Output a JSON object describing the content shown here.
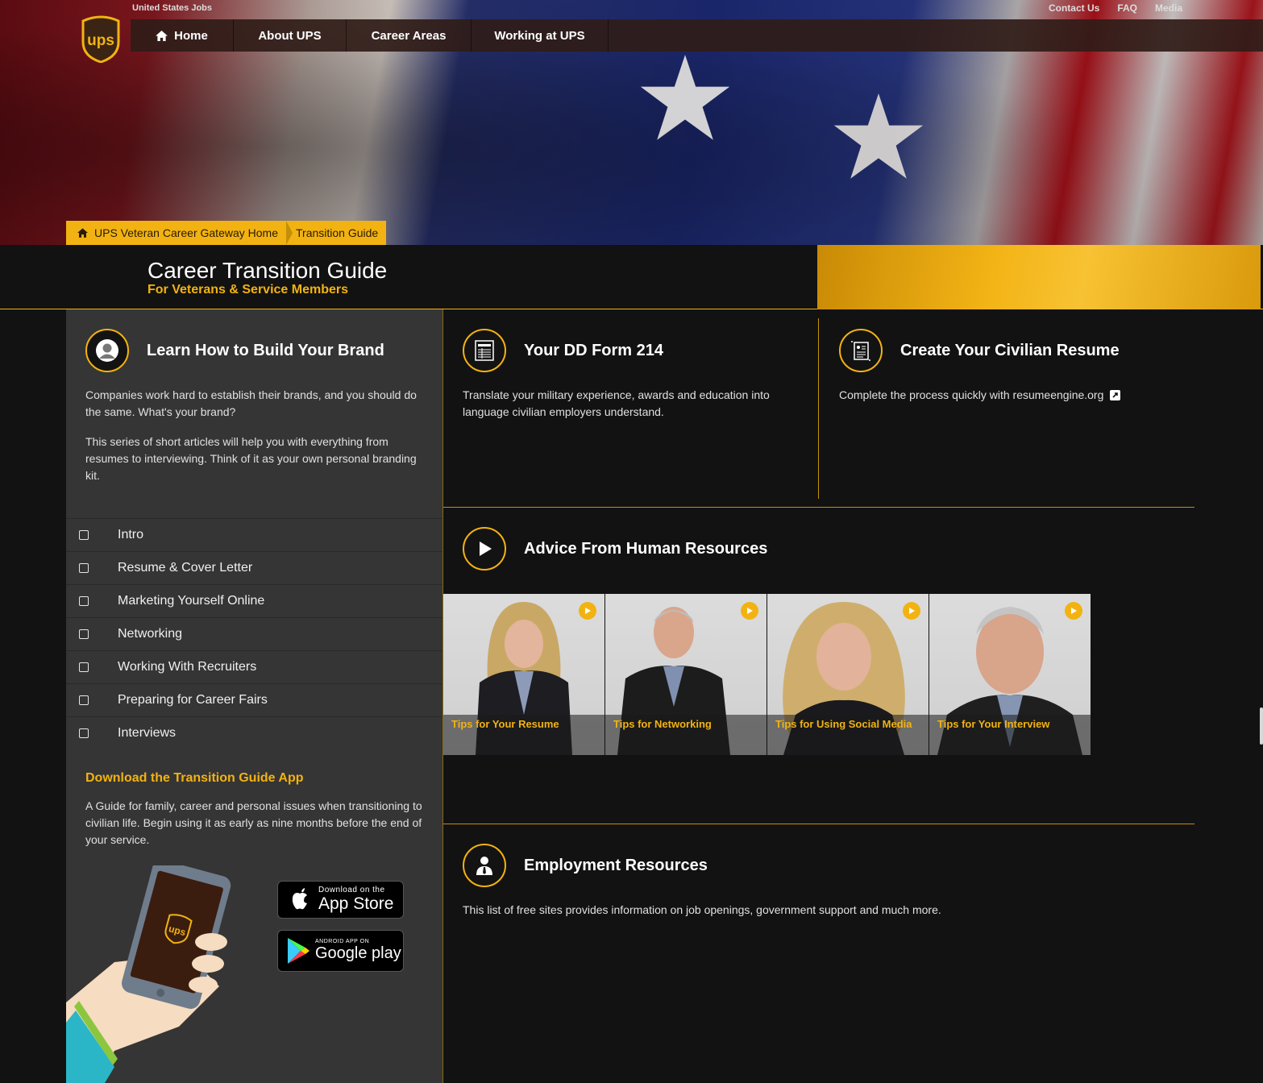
{
  "header": {
    "site_label": "United States Jobs",
    "util_links": [
      "Contact Us",
      "FAQ",
      "Media"
    ],
    "nav": [
      "Home",
      "About UPS",
      "Career Areas",
      "Working at UPS"
    ],
    "logo_text": "ups"
  },
  "breadcrumb": [
    "UPS Veteran Career Gateway Home",
    "Transition Guide"
  ],
  "title": {
    "main": "Career Transition Guide",
    "sub": "For Veterans & Service Members"
  },
  "brand": {
    "heading": "Learn How to Build Your Brand",
    "p1": "Companies work hard to establish their brands, and you should do the same. What's your brand?",
    "p2": "This series of short articles will help you with everything from resumes to interviewing. Think of it as your own personal branding kit.",
    "topics": [
      "Intro",
      "Resume & Cover Letter",
      "Marketing Yourself Online",
      "Networking",
      "Working With Recruiters",
      "Preparing for Career Fairs",
      "Interviews"
    ]
  },
  "app": {
    "heading": "Download the Transition Guide App",
    "text": "A Guide for family, career and personal issues when transitioning to civilian life. Begin using it as early as nine months before the end of your service.",
    "appstore_small": "Download on the",
    "appstore_big": "App Store",
    "play_small": "ANDROID APP ON",
    "play_big": "Google play",
    "phone_logo": "ups"
  },
  "dd214": {
    "heading": "Your DD Form 214",
    "text": "Translate your military experience, awards and education into language civilian employers understand."
  },
  "resume": {
    "heading": "Create Your Civilian Resume",
    "text": "Complete the process quickly with resumeengine.org"
  },
  "advice": {
    "heading": "Advice From Human Resources",
    "videos": [
      "Tips for Your Resume",
      "Tips for Networking",
      "Tips for Using Social Media",
      "Tips for Your Interview"
    ]
  },
  "employment": {
    "heading": "Employment Resources",
    "text": "This list of free sites provides information on job openings, government support and much more."
  },
  "colors": {
    "accent": "#f2b312",
    "background": "#131212",
    "panel": "#363535"
  }
}
